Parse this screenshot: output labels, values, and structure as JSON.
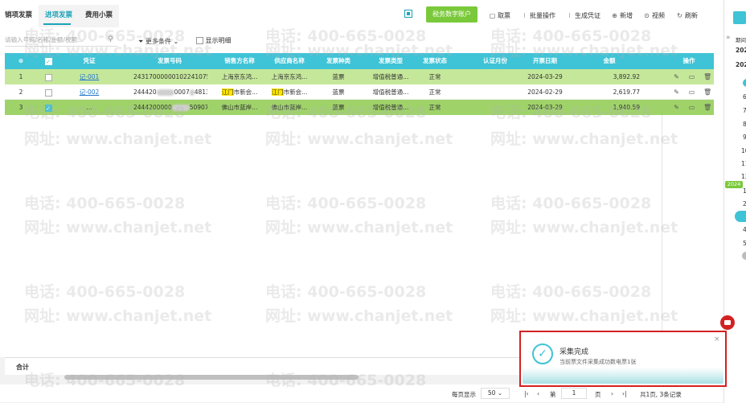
{
  "tabs": [
    {
      "label": "销项发票",
      "active": false
    },
    {
      "label": "进项发票",
      "active": true
    },
    {
      "label": "费用小票",
      "active": false
    }
  ],
  "toolbar": {
    "green_button": "税务数字账户",
    "cancel": "取票",
    "batch": "批量操作",
    "generate": "生成凭证",
    "add": "新增",
    "video": "视频",
    "refresh": "刷新"
  },
  "filter": {
    "search_placeholder": "请输入号码/名称/金额/税额...",
    "more_conditions": "更多条件",
    "show_detail": "显示明细"
  },
  "table": {
    "headers": [
      "序",
      "",
      "凭证",
      "发票号码",
      "销售方名称",
      "供应商名称",
      "发票种类",
      "发票类型",
      "发票状态",
      "认证月份",
      "开票日期",
      "金额",
      "操作"
    ],
    "rows": [
      {
        "idx": "1",
        "checked": false,
        "voucher": "记-001",
        "invoice_no": "24317000000102241075",
        "seller": "上海京东鸿...",
        "supplier": "上海京东鸿...",
        "kind": "蓝票",
        "type": "增值税普通...",
        "status": "正常",
        "month": "",
        "date": "2024-03-29",
        "amount": "3,892.92"
      },
      {
        "idx": "2",
        "checked": false,
        "voucher": "记-002",
        "invoice_no_a": "244420",
        "invoice_no_b": "0007",
        "invoice_no_c": "48138",
        "seller_hl": "江门",
        "seller": "市新会...",
        "supplier_hl": "江门",
        "supplier": "市新会...",
        "kind": "蓝票",
        "type": "增值税普通...",
        "status": "正常",
        "month": "",
        "date": "2024-02-29",
        "amount": "2,619.77"
      },
      {
        "idx": "3",
        "checked": true,
        "voucher": "...",
        "invoice_no_a": "2444200000",
        "invoice_no_c": "5090793",
        "seller": "佛山市蓝岸...",
        "supplier": "佛山市蓝岸...",
        "kind": "蓝票",
        "type": "增值税普通...",
        "status": "正常",
        "month": "",
        "date": "2024-03-29",
        "amount": "1,940.59"
      }
    ]
  },
  "summary": {
    "label": "合计"
  },
  "pager": {
    "per_page_label": "每页显示",
    "per_page": "50",
    "page_prefix": "第",
    "page": "1",
    "page_suffix": "页",
    "total": "共1页, 3条记录"
  },
  "right_panel": {
    "items": [
      "期间",
      "202",
      "202",
      "6",
      "7",
      "8",
      "9",
      "10",
      "11",
      "12",
      "1",
      "2",
      "3",
      "4",
      "5"
    ],
    "tag": "2024"
  },
  "toast": {
    "title": "采集完成",
    "message": "当前票文件采集成功数电票1张"
  },
  "watermark": {
    "phone": "电话: 400-665-0028",
    "site": "网址: www.chanjet.net"
  },
  "colors": {
    "accent": "#3fc3d6",
    "green": "#7ac93a",
    "highlight": "#ffe600",
    "alert": "#d32121"
  }
}
